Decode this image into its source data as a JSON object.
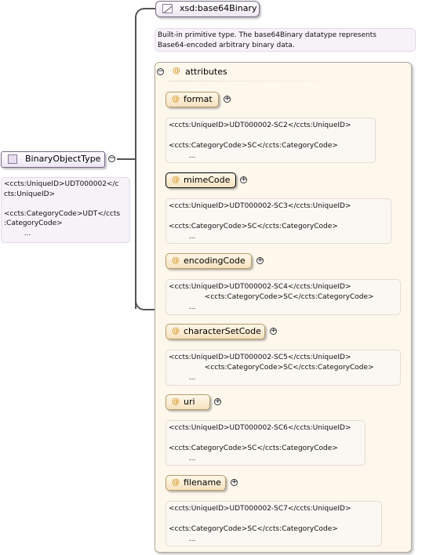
{
  "root": {
    "name": "BinaryObjectType",
    "doc": "<ccts:UniqueID>UDT000002</c\ncts:UniqueID>\n\n<ccts:CategoryCode>UDT</ccts\n:CategoryCode>\n         ..."
  },
  "base": {
    "name": "xsd:base64Binary",
    "doc": "Built-in primitive type. The base64Binary datatype represents\nBase64-encoded arbitrary binary data."
  },
  "attributes_group": {
    "label": "attributes"
  },
  "attributes": [
    {
      "name": "format",
      "doc": "<ccts:UniqueID>UDT000002-SC2</ccts:UniqueID>\n\n<ccts:CategoryCode>SC</ccts:CategoryCode>\n         ..."
    },
    {
      "name": "mimeCode",
      "doc": "<ccts:UniqueID>UDT000002-SC3</ccts:UniqueID>\n\n<ccts:CategoryCode>SC</ccts:CategoryCode>\n         ..."
    },
    {
      "name": "encodingCode",
      "doc": "<ccts:UniqueID>UDT000002-SC4</ccts:UniqueID>\n                <ccts:CategoryCode>SC</ccts:CategoryCode>\n         ..."
    },
    {
      "name": "characterSetCode",
      "doc": "<ccts:UniqueID>UDT000002-SC5</ccts:UniqueID>\n                <ccts:CategoryCode>SC</ccts:CategoryCode>\n         ..."
    },
    {
      "name": "uri",
      "doc": "<ccts:UniqueID>UDT000002-SC6</ccts:UniqueID>\n\n<ccts:CategoryCode>SC</ccts:CategoryCode>\n         ..."
    },
    {
      "name": "filename",
      "doc": "<ccts:UniqueID>UDT000002-SC7</ccts:UniqueID>\n\n<ccts:CategoryCode>SC</ccts:CategoryCode>\n         ..."
    }
  ],
  "icons": {
    "root": "complex-type-icon",
    "base": "simple-type-icon",
    "attribute": "attribute-at-icon",
    "expand": "plus-circle-icon",
    "collapse": "minus-circle-icon"
  },
  "colors": {
    "node_border": "#7a6a86",
    "attr_fill": "#f6e2bf",
    "attr_at": "#d48b10",
    "group_fill": "#fdf7ec"
  }
}
